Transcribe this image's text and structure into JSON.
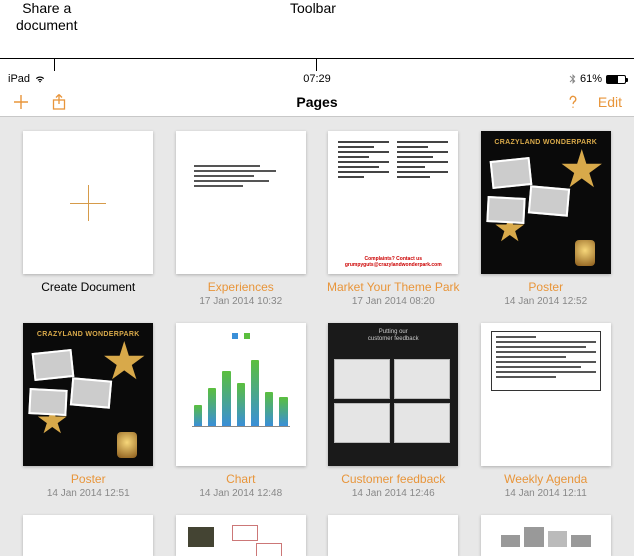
{
  "annotations": {
    "share": "Share a\ndocument",
    "toolbar": "Toolbar"
  },
  "statusbar": {
    "device": "iPad",
    "time": "07:29",
    "battery_pct": "61%"
  },
  "toolbar": {
    "title": "Pages",
    "edit_label": "Edit"
  },
  "documents": [
    {
      "title": "Create Document",
      "date": "",
      "title_black": true
    },
    {
      "title": "Experiences",
      "date": "17 Jan 2014 10:32"
    },
    {
      "title": "Market Your Theme Park",
      "date": "17 Jan 2014 08:20"
    },
    {
      "title": "Poster",
      "date": "14 Jan 2014 12:52"
    },
    {
      "title": "Poster",
      "date": "14 Jan 2014 12:51"
    },
    {
      "title": "Chart",
      "date": "14 Jan 2014 12:48"
    },
    {
      "title": "Customer feedback",
      "date": "14 Jan 2014 12:46"
    },
    {
      "title": "Weekly Agenda",
      "date": "14 Jan 2014 12:11"
    }
  ],
  "thumb_text": {
    "poster_title": "CRAZYLAND WONDERPARK",
    "fb_l1": "Putting our",
    "fb_l2": "customer feedback"
  }
}
